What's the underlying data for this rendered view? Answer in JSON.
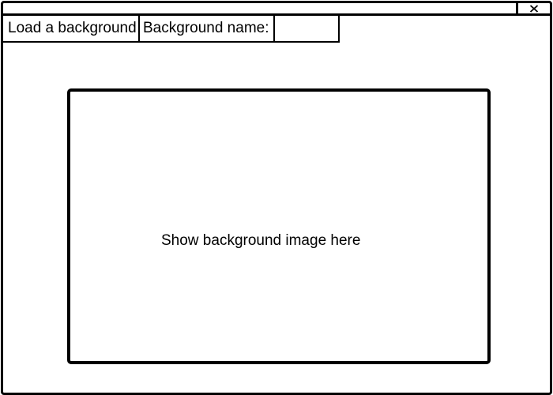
{
  "window": {
    "close_icon": "close-icon"
  },
  "toolbar": {
    "load_label": "Load a background",
    "name_label": "Background name:",
    "name_value": "",
    "name_placeholder": ""
  },
  "preview": {
    "placeholder_text": "Show background image here"
  }
}
